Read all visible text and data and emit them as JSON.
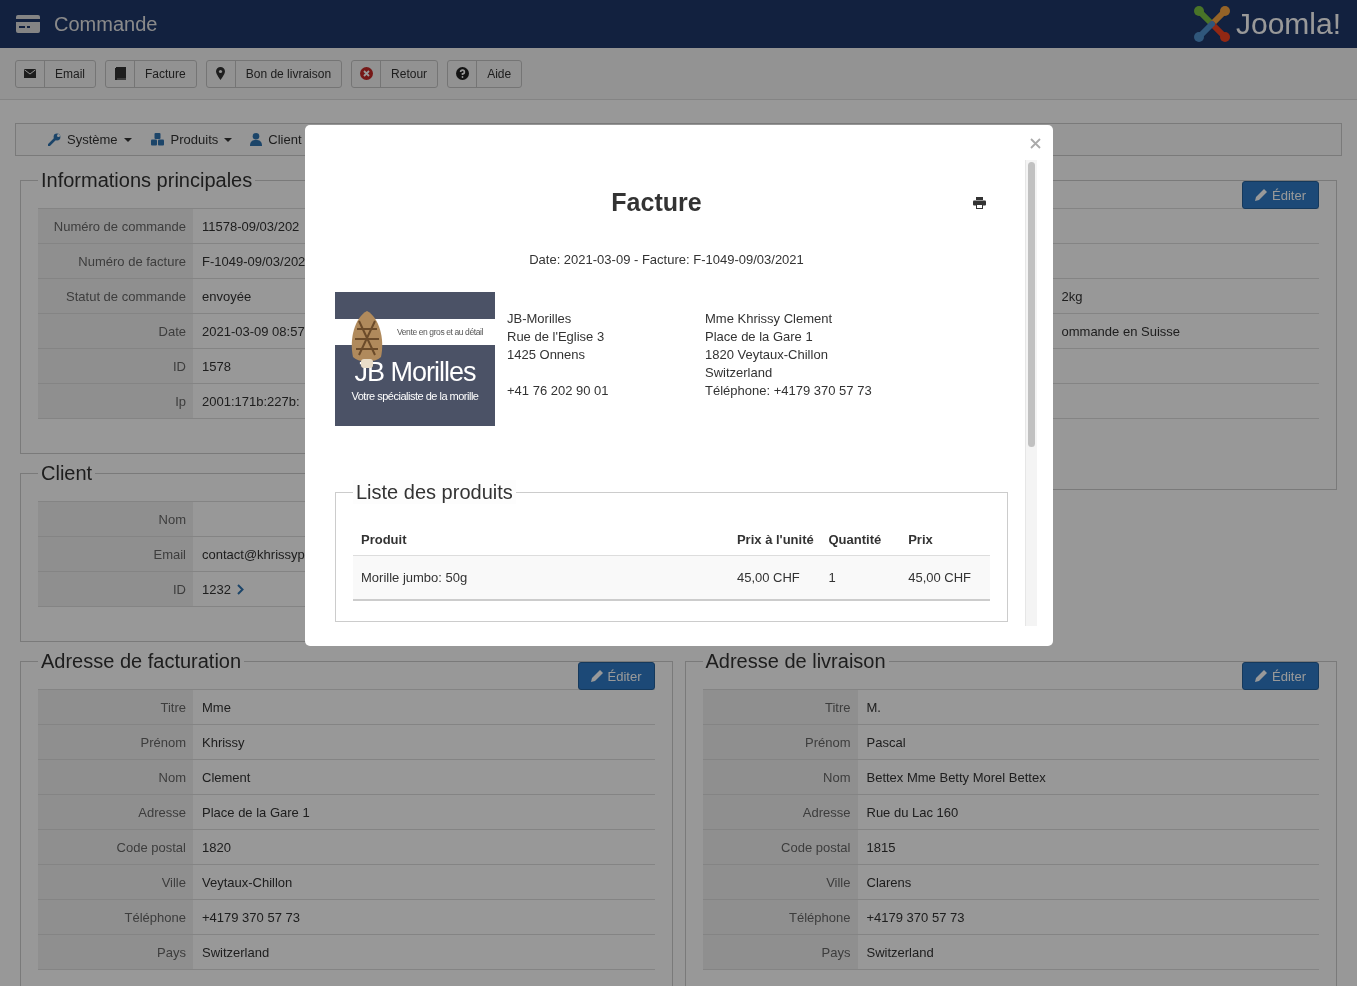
{
  "header": {
    "title": "Commande",
    "brand": "Joomla!"
  },
  "toolbar": [
    {
      "label": "Email",
      "kind": "envelope"
    },
    {
      "label": "Facture",
      "kind": "book"
    },
    {
      "label": "Bon de livraison",
      "kind": "pin"
    },
    {
      "label": "Retour",
      "kind": "cancel"
    },
    {
      "label": "Aide",
      "kind": "help"
    }
  ],
  "submenu": [
    {
      "label": "Système",
      "kind": "wrench",
      "dropdown": true
    },
    {
      "label": "Produits",
      "kind": "cubes",
      "dropdown": true
    },
    {
      "label": "Client",
      "kind": "user",
      "dropdown": false
    }
  ],
  "main_info": {
    "legend": "Informations principales",
    "rows": [
      {
        "label": "Numéro de commande",
        "value": "11578-09/03/202"
      },
      {
        "label": "Numéro de facture",
        "value": "F-1049-09/03/202"
      },
      {
        "label": "Statut de commande",
        "value": "envoyée"
      },
      {
        "label": "Date",
        "value": "2021-03-09 08:57"
      },
      {
        "label": "ID",
        "value": "1578"
      },
      {
        "label": "Ip",
        "value": "2001:171b:227b:"
      }
    ]
  },
  "client": {
    "legend": "Client",
    "rows": [
      {
        "label": "Nom"
      },
      {
        "label": "Email",
        "value": "contact@khrissyp"
      },
      {
        "label": "ID",
        "value": "1232",
        "link": true
      }
    ]
  },
  "order_details": {
    "button": "Éditer",
    "rows": [
      {},
      {},
      {
        "value": "2kg"
      },
      {
        "value": "ommande en Suisse"
      },
      {},
      {}
    ]
  },
  "billing": {
    "legend": "Adresse de facturation",
    "button": "Éditer",
    "rows": [
      {
        "label": "Titre",
        "value": "Mme"
      },
      {
        "label": "Prénom",
        "value": "Khrissy"
      },
      {
        "label": "Nom",
        "value": "Clement"
      },
      {
        "label": "Adresse",
        "value": "Place de la Gare 1"
      },
      {
        "label": "Code postal",
        "value": "1820"
      },
      {
        "label": "Ville",
        "value": "Veytaux-Chillon"
      },
      {
        "label": "Téléphone",
        "value": "+4179 370 57 73"
      },
      {
        "label": "Pays",
        "value": "Switzerland"
      }
    ]
  },
  "shipping": {
    "legend": "Adresse de livraison",
    "button": "Éditer",
    "rows": [
      {
        "label": "Titre",
        "value": "M."
      },
      {
        "label": "Prénom",
        "value": "Pascal"
      },
      {
        "label": "Nom",
        "value": "Bettex Mme Betty Morel Bettex"
      },
      {
        "label": "Adresse",
        "value": "Rue du Lac 160"
      },
      {
        "label": "Code postal",
        "value": "1815"
      },
      {
        "label": "Ville",
        "value": "Clarens"
      },
      {
        "label": "Téléphone",
        "value": "+4179 370 57 73"
      },
      {
        "label": "Pays",
        "value": "Switzerland"
      }
    ]
  },
  "modal": {
    "title": "Facture",
    "meta": "Date: 2021-03-09 - Facture: F-1049-09/03/2021",
    "logo": {
      "tagline": "Vente en gros et au détail",
      "brand": "JB Morilles",
      "slogan": "Votre spécialiste de la morille"
    },
    "seller": {
      "lines": [
        "JB-Morilles",
        "Rue de l'Eglise 3",
        "1425 Onnens"
      ],
      "phone": "+41 76 202 90 01"
    },
    "buyer": {
      "lines": [
        "Mme Khrissy Clement",
        "Place de la Gare 1",
        "1820 Veytaux-Chillon",
        "Switzerland",
        "Téléphone: +4179 370 57 73"
      ]
    },
    "products": {
      "legend": "Liste des produits",
      "columns": [
        "Produit",
        "Prix à l'unité",
        "Quantité",
        "Prix"
      ],
      "rows": [
        [
          "Morille jumbo: 50g",
          "45,00 CHF",
          "1",
          "45,00 CHF"
        ]
      ]
    }
  }
}
